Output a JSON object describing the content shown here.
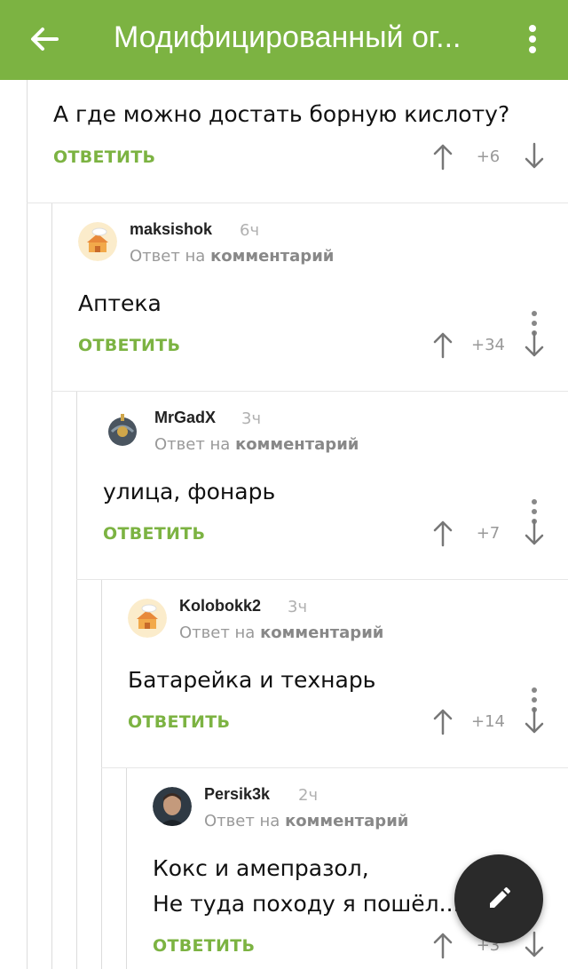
{
  "appbar": {
    "title": "Модифицированный ог..."
  },
  "comments": [
    {
      "text": "А где можно достать борную кислоту?",
      "reply_label": "ОТВЕТИТЬ",
      "score": "+6"
    },
    {
      "username": "maksishok",
      "time": "6ч",
      "reply_prefix": "Ответ на",
      "reply_target": "комментарий",
      "text": "Аптека",
      "reply_label": "ОТВЕТИТЬ",
      "score": "+34",
      "avatar": "house-avatar"
    },
    {
      "username": "MrGadX",
      "time": "3ч",
      "reply_prefix": "Ответ на",
      "reply_target": "комментарий",
      "text": "улица, фонарь",
      "reply_label": "ОТВЕТИТЬ",
      "score": "+7",
      "avatar": "helmet-avatar"
    },
    {
      "username": "Kolobokk2",
      "time": "3ч",
      "reply_prefix": "Ответ на",
      "reply_target": "комментарий",
      "text": "Батарейка и технарь",
      "reply_label": "ОТВЕТИТЬ",
      "score": "+14",
      "avatar": "house-avatar"
    },
    {
      "username": "Persik3k",
      "time": "2ч",
      "reply_prefix": "Ответ на",
      "reply_target": "комментарий",
      "text_line1": "Кокс и амепразол,",
      "text_line2": "Не туда походу я пошёл...",
      "reply_label": "ОТВЕТИТЬ",
      "score": "+3",
      "avatar": "person-avatar"
    }
  ],
  "colors": {
    "accent": "#7cb342",
    "fab": "#2a2a2a"
  }
}
